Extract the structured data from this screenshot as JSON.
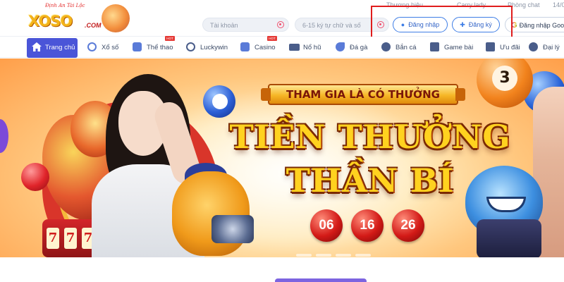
{
  "header": {
    "logo_tagline": "Định An Tài Lộc",
    "logo_text": "XOSO",
    "logo_suffix": ".COM",
    "top_links": [
      "Thương hiệu",
      "Carry lady",
      "Phòng chat",
      "14/0"
    ],
    "username_placeholder": "Tài khoản",
    "password_placeholder": "6-15 ký tự chữ và số",
    "login_label": "Đăng nhập",
    "register_label": "Đăng ký",
    "google_label": "Đăng nhập Goo"
  },
  "nav": {
    "items": [
      {
        "label": "Trang chủ",
        "icon": "home-icon",
        "active": true
      },
      {
        "label": "Xổ số",
        "icon": "lottery-icon"
      },
      {
        "label": "Thể thao",
        "icon": "sports-icon",
        "hot": true
      },
      {
        "label": "Luckywin",
        "icon": "luckywin-icon"
      },
      {
        "label": "Casino",
        "icon": "casino-icon",
        "hot": true
      },
      {
        "label": "Nổ hũ",
        "icon": "jackpot-icon"
      },
      {
        "label": "Đá gà",
        "icon": "cockfight-icon"
      },
      {
        "label": "Bắn cá",
        "icon": "fish-icon"
      },
      {
        "label": "Game bài",
        "icon": "cards-icon"
      },
      {
        "label": "Ưu đãi",
        "icon": "gift-icon"
      },
      {
        "label": "Đại lý",
        "icon": "agent-icon"
      }
    ],
    "hot_label": "HOT"
  },
  "banner": {
    "ribbon": "THAM GIA LÀ CÓ THƯỞNG",
    "title_line1": "TIỀN THƯỞNG",
    "title_line2": "THẦN BÍ",
    "balls": [
      "06",
      "16",
      "26"
    ],
    "slot_digits": [
      "7",
      "7",
      "7"
    ],
    "corner_ball_number": "3",
    "accent_color": "#ffd21f",
    "nav_active_color": "#4a55d8"
  }
}
